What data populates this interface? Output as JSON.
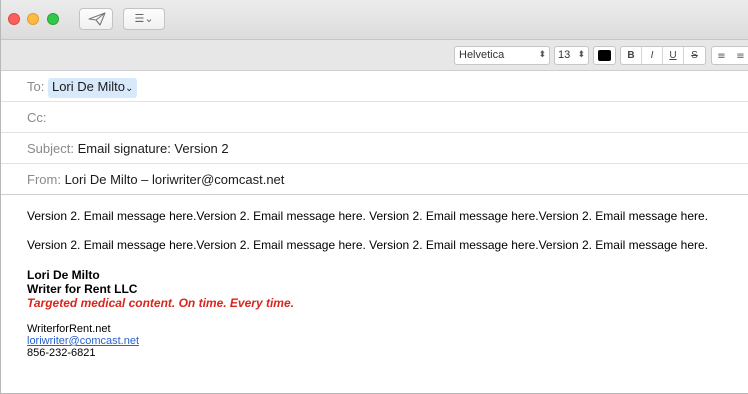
{
  "toolbar": {
    "list_button_label": "☰⌄"
  },
  "format_bar": {
    "font": "Helvetica",
    "size": "13",
    "text_color": "#000000",
    "style_buttons": [
      "B",
      "I",
      "U",
      "S"
    ],
    "align_buttons": [
      "≡",
      "≡",
      "≡"
    ]
  },
  "headers": {
    "to_label": "To:",
    "to_value": "Lori De Milto",
    "to_chevron": "⌄",
    "cc_label": "Cc:",
    "subject_label": "Subject:",
    "subject_value": "Email signature: Version 2",
    "from_label": "From:",
    "from_value": "Lori De Milto – loriwriter@comcast.net"
  },
  "body": {
    "paragraph_1": "Version 2. Email message here.Version 2. Email message here. Version 2. Email message here.Version 2. Email message here.",
    "paragraph_2": "Version 2. Email message here.Version 2. Email message here. Version 2. Email message here.Version 2. Email message here.",
    "signature": {
      "name": "Lori De Milto",
      "company": "Writer for Rent LLC",
      "tagline": "Targeted medical  content. On time. Every time.",
      "website": "WriterforRent.net",
      "email": "loriwriter@comcast.net",
      "phone": "856-232-6821"
    }
  },
  "colors": {
    "tagline": "#d7261e",
    "link": "#2a62c9",
    "recipient_bg": "#d8e9fb"
  }
}
